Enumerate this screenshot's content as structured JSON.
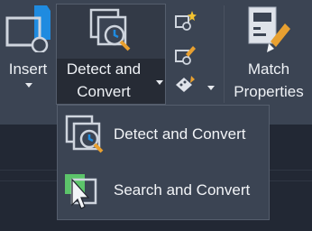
{
  "ribbon": {
    "insert": {
      "label": "Insert",
      "icon": "insert-block-icon"
    },
    "detect_convert": {
      "label_line1": "Detect and",
      "label_line2": "Convert",
      "icon": "detect-convert-icon"
    },
    "small_tools": [
      {
        "icon": "star-block-icon"
      },
      {
        "icon": "pencil-block-icon"
      },
      {
        "icon": "paint-bucket-icon"
      }
    ],
    "match_properties": {
      "label_line1": "Match",
      "label_line2": "Properties",
      "icon": "match-properties-icon"
    }
  },
  "flyout": {
    "items": [
      {
        "label": "Detect and Convert",
        "icon": "detect-convert-icon"
      },
      {
        "label": "Search and Convert",
        "icon": "search-convert-icon"
      }
    ]
  },
  "colors": {
    "ribbon_bg": "#3b4453",
    "canvas_bg": "#222834",
    "accent_blue": "#1f8be0",
    "accent_green": "#5cc46a",
    "text": "#f2f4f7"
  }
}
